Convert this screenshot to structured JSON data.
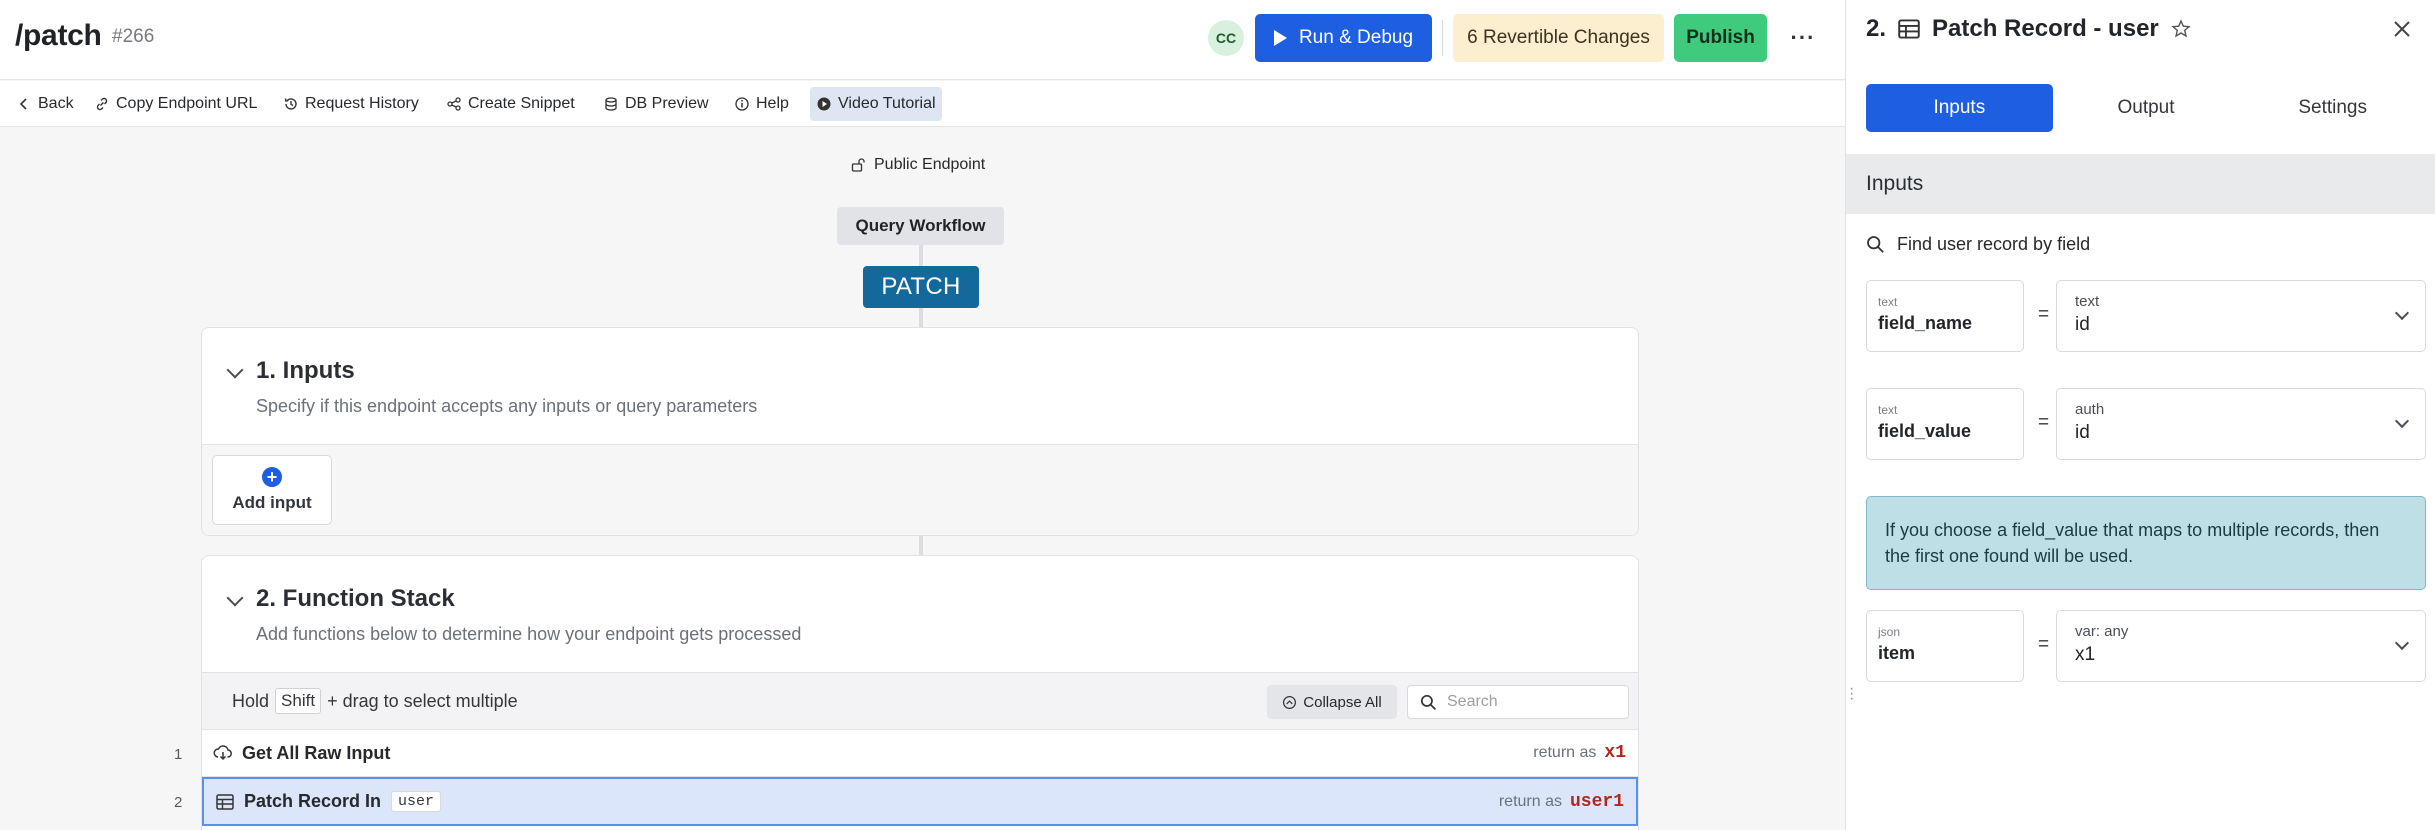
{
  "header": {
    "title": "/patch",
    "id_label": "#266",
    "avatar_initials": "CC",
    "run_debug_label": "Run & Debug",
    "revertible_label": "6 Revertible Changes",
    "publish_label": "Publish",
    "more_label": "···"
  },
  "toolbar": {
    "items": [
      {
        "label": "Back",
        "icon": "chevron-left-icon"
      },
      {
        "label": "Copy Endpoint URL",
        "icon": "link-icon"
      },
      {
        "label": "Request History",
        "icon": "history-icon"
      },
      {
        "label": "Create Snippet",
        "icon": "share-icon"
      },
      {
        "label": "DB Preview",
        "icon": "database-icon"
      },
      {
        "label": "Help",
        "icon": "info-icon"
      },
      {
        "label": "Video Tutorial",
        "icon": "play-circle-icon",
        "active": true
      }
    ]
  },
  "canvas": {
    "public_endpoint_label": "Public Endpoint",
    "workflow_label": "Query Workflow",
    "method_label": "PATCH",
    "inputs_section": {
      "title": "1. Inputs",
      "subtitle": "Specify if this endpoint accepts any inputs or query parameters",
      "add_input_label": "Add input"
    },
    "function_stack": {
      "title": "2. Function Stack",
      "subtitle": "Add functions below to determine how your endpoint gets processed",
      "hint_prefix": "Hold",
      "hint_key": "Shift",
      "hint_suffix": "+ drag to select multiple",
      "collapse_all_label": "Collapse All",
      "search_placeholder": "Search",
      "rows": [
        {
          "num": "1",
          "icon": "cloud-download-icon",
          "name": "Get All Raw Input",
          "tag": "",
          "return_prefix": "return as",
          "return_var": "x1",
          "selected": false
        },
        {
          "num": "2",
          "icon": "table-icon",
          "name": "Patch Record In",
          "tag": "user",
          "return_prefix": "return as",
          "return_var": "user1",
          "selected": true
        }
      ]
    }
  },
  "panel": {
    "step_title": "2.",
    "title": "Patch Record - user",
    "tabs": [
      {
        "label": "Inputs",
        "active": true
      },
      {
        "label": "Output",
        "active": false
      },
      {
        "label": "Settings",
        "active": false
      }
    ],
    "section_label": "Inputs",
    "find_label": "Find user record by field",
    "params": [
      {
        "type": "text",
        "name": "field_name",
        "eq": "=",
        "value_type": "text",
        "value": "id"
      },
      {
        "type": "text",
        "name": "field_value",
        "eq": "=",
        "value_type": "auth",
        "value": "id"
      },
      {
        "type": "json",
        "name": "item",
        "eq": "=",
        "value_type": "var: any",
        "value": "x1"
      }
    ],
    "note": "If you choose a field_value that maps to multiple records, then the first one found will be used."
  },
  "colors": {
    "primary": "#1d5fe0",
    "publish": "#3fcb7d",
    "revertible_bg": "#fcefcf",
    "method_bg": "#13699b",
    "return_var": "#b3261e",
    "selected_row_bg": "#dbe6fb",
    "note_bg": "#bfdfe7"
  }
}
